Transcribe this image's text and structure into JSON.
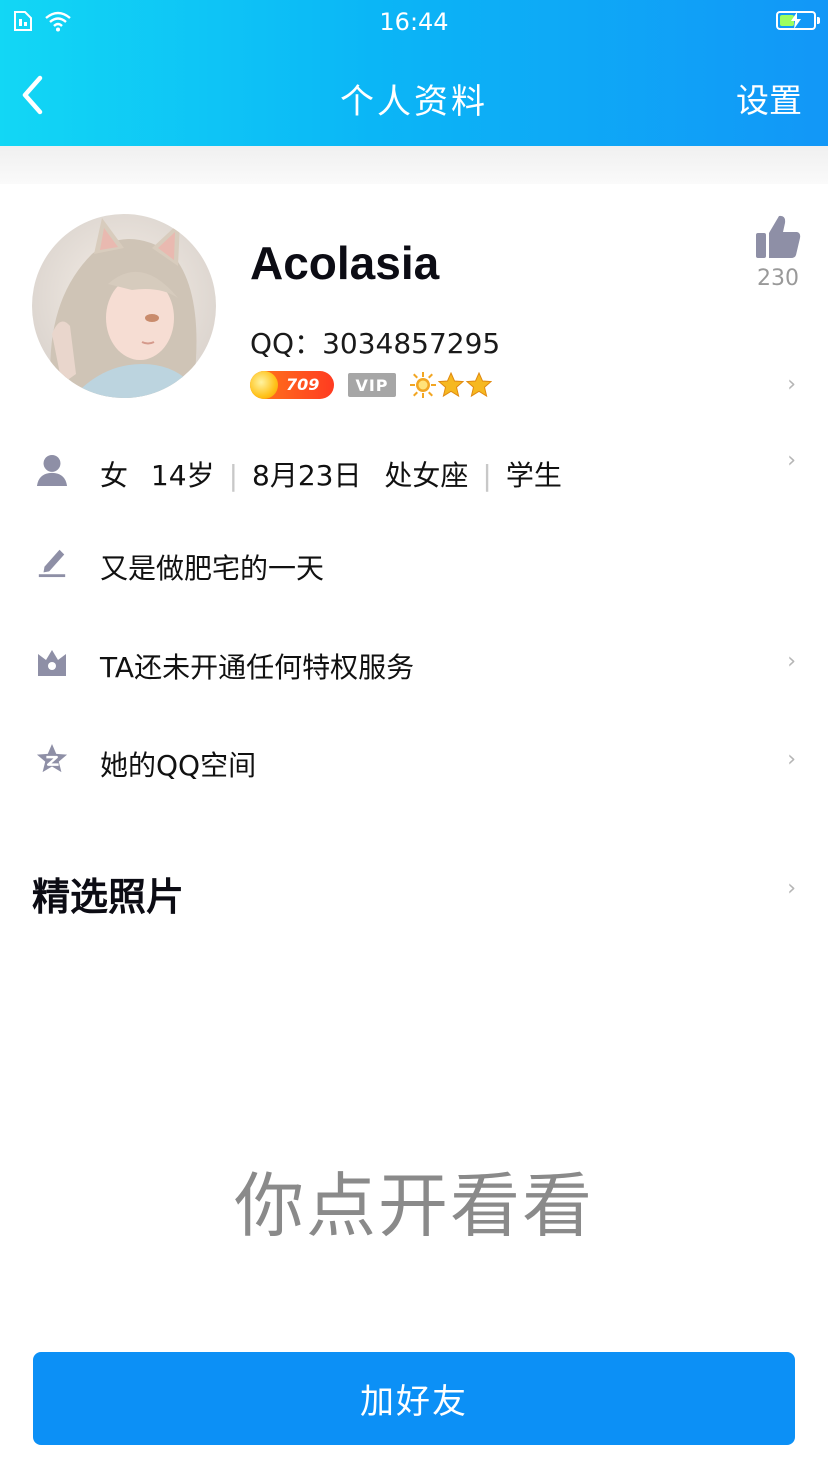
{
  "status_bar": {
    "time": "16:44"
  },
  "nav": {
    "title": "个人资料",
    "settings_label": "设置"
  },
  "profile": {
    "nickname": "Acolasia",
    "qq_label": "QQ：3034857295",
    "likes": "230",
    "coin_badge_value": "709",
    "vip_label": "VIP"
  },
  "rows": {
    "basic_info": {
      "gender": "女",
      "age": "14岁",
      "birthday": "8月23日",
      "zodiac": "处女座",
      "occupation": "学生"
    },
    "signature": "又是做肥宅的一天",
    "privilege": "TA还未开通任何特权服务",
    "qzone": "她的QQ空间"
  },
  "photos": {
    "section_title": "精选照片",
    "hint_text": "你点开看看"
  },
  "actions": {
    "add_friend_label": "加好友"
  },
  "colors": {
    "header_gradient_start": "#12d7f5",
    "header_gradient_end": "#1297f7",
    "button_blue": "#0c90f6",
    "icon_gray": "#8e8fa6"
  },
  "icons": {
    "back": "chevron-left-icon",
    "like": "thumbs-up-icon",
    "person": "person-icon",
    "signature": "pencil-icon",
    "privilege": "crown-icon",
    "qzone": "qzone-star-icon"
  }
}
